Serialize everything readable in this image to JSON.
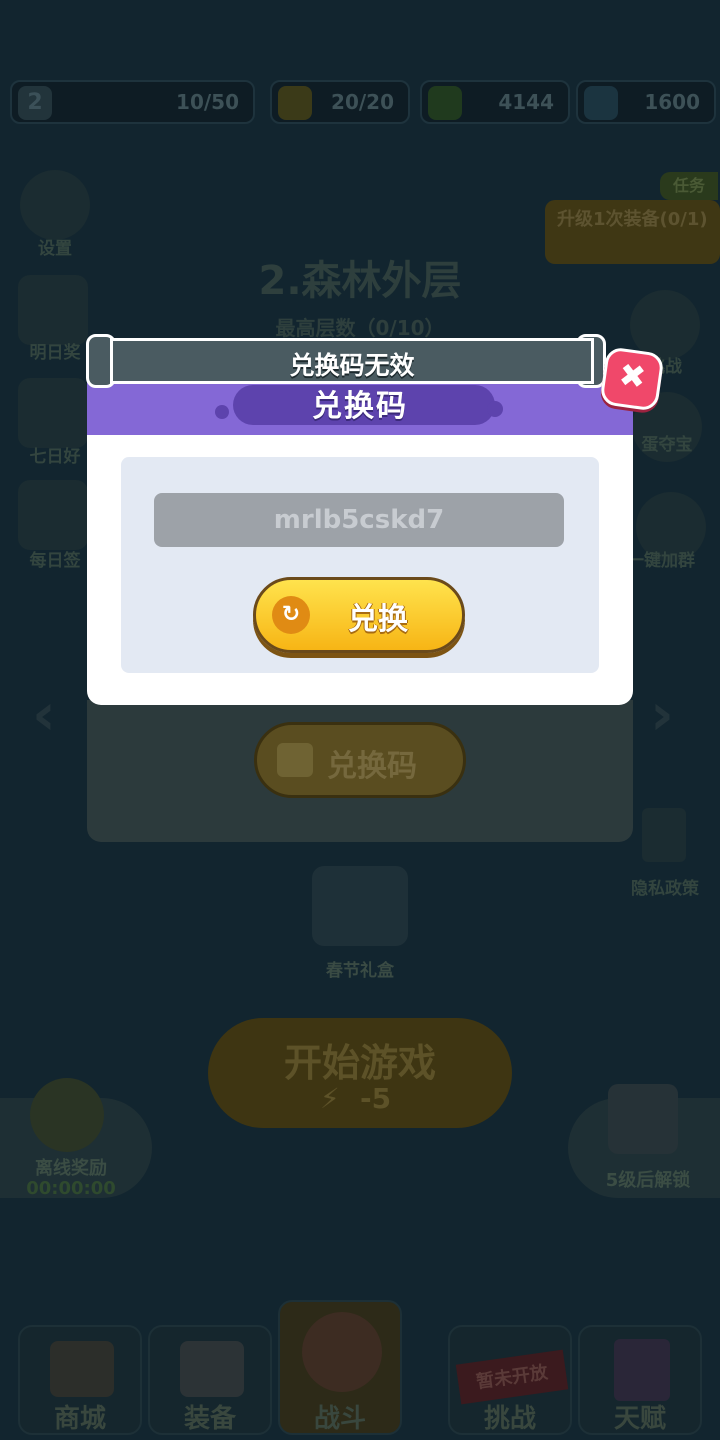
{
  "top_bar": {
    "level": "2",
    "exp": "10/50",
    "energy": "20/20",
    "cash": "4144",
    "gems": "1600"
  },
  "left_menu": {
    "settings": "设置",
    "tomorrow": "明日奖",
    "seven_day": "七日好",
    "daily_signin": "每日签"
  },
  "right_menu": {
    "task_tag": "任务",
    "task_text": "升级1次装备(0/1)",
    "challenge": "挑战",
    "egg_treasure": "蛋夺宝",
    "join_group": "一键加群",
    "privacy": "隐私政策"
  },
  "stage": {
    "title": "2.森林外层",
    "progress": "最高层数（0/10）"
  },
  "festival_gift": "春节礼盒",
  "start_game": {
    "label": "开始游戏",
    "cost": "-5"
  },
  "offline_reward": {
    "label": "离线奖励",
    "timer": "00:00:00"
  },
  "unlock_hint": "5级后解锁",
  "bottom_nav": {
    "shop": "商城",
    "equipment": "装备",
    "battle": "战斗",
    "challenge": "挑战",
    "not_open": "暂未开放",
    "talent": "天赋"
  },
  "background_button": "兑换码",
  "dialog": {
    "title": "兑换码",
    "input_value": "mrlb5cskd7",
    "redeem_label": "兑换",
    "close_symbol": "✖"
  },
  "toast": {
    "message": "兑换码无效"
  },
  "colors": {
    "dialog_header": "#8468d6",
    "redeem_button": "#f7b515",
    "close_button": "#f0486a"
  }
}
